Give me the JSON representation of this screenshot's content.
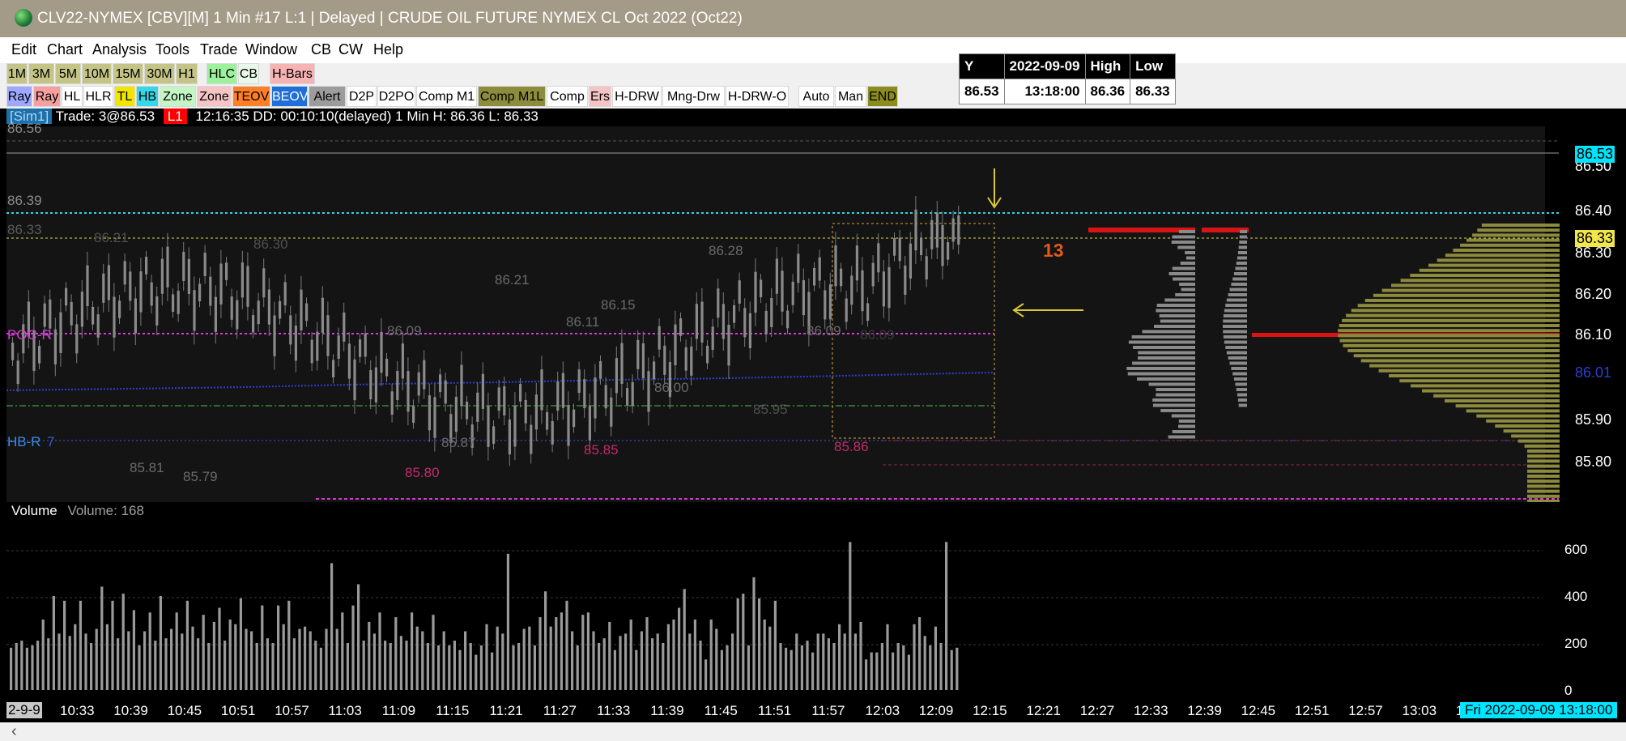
{
  "window": {
    "title": "CLV22-NYMEX [CBV][M]  1 Min   #17 L:1 | Delayed | CRUDE OIL FUTURE NYMEX CL Oct 2022 (Oct22)",
    "icon": "globe-icon"
  },
  "menu": [
    "Edit",
    "Chart",
    "Analysis",
    "Tools",
    "Trade",
    "Window",
    "CB",
    "CW",
    "Help"
  ],
  "toolbar_timeframes": [
    {
      "label": "1M",
      "color": "#c4c486"
    },
    {
      "label": "3M",
      "color": "#c4c486"
    },
    {
      "label": "5M",
      "color": "#c4c486"
    },
    {
      "label": "10M",
      "color": "#c4c486"
    },
    {
      "label": "15M",
      "color": "#c4c486"
    },
    {
      "label": "30M",
      "color": "#c4c486"
    },
    {
      "label": "H1",
      "color": "#c4c486"
    },
    {
      "label": "HLC",
      "color": "#9cf29c"
    },
    {
      "label": "CB",
      "color": "#e8f7e8"
    },
    {
      "label": "H-Bars",
      "color": "#f5b3b3"
    }
  ],
  "toolbar_tools": [
    {
      "label": "Ray",
      "color": "#9ea8ff"
    },
    {
      "label": "Ray",
      "color": "#f4a0a0"
    },
    {
      "label": "HL",
      "color": "#ffffff"
    },
    {
      "label": "HLR",
      "color": "#ffffff"
    },
    {
      "label": "TL",
      "color": "#f2e600"
    },
    {
      "label": "HB",
      "color": "#36d7e8"
    },
    {
      "label": "Zone",
      "color": "#c4f5c4"
    },
    {
      "label": "Zone",
      "color": "#f5c4c4"
    },
    {
      "label": "TEOV",
      "color": "#ff7f27"
    },
    {
      "label": "BEOV",
      "color": "#1e6fd9"
    },
    {
      "label": "Alert",
      "color": "#9c9c9c"
    },
    {
      "label": "D2P",
      "color": "#ffffff"
    },
    {
      "label": "D2PO",
      "color": "#ffffff"
    },
    {
      "label": "Comp M1",
      "color": "#ffffff"
    },
    {
      "label": "Comp M1L",
      "color": "#8c8c3c"
    },
    {
      "label": "Comp",
      "color": "#ffffff"
    },
    {
      "label": "Ers",
      "color": "#f5c4c4"
    },
    {
      "label": "H-DRW",
      "color": "#ffffff"
    },
    {
      "label": "Mng-Drw",
      "color": "#ffffff"
    },
    {
      "label": "H-DRW-O",
      "color": "#ffffff"
    },
    {
      "label": "Auto",
      "color": "#ffffff"
    },
    {
      "label": "Man",
      "color": "#ffffff"
    },
    {
      "label": "END",
      "color": "#8c8c1c"
    }
  ],
  "info_table": {
    "headers": [
      "Y",
      "2022-09-09",
      "High",
      "Low"
    ],
    "values": [
      "86.53",
      "13:18:00",
      "86.36",
      "86.33"
    ]
  },
  "status_line": {
    "sim": "[Sim1]",
    "trade": "Trade: 3@86.53",
    "badge": "L1",
    "text": "12:16:35 DD: 00:10:10(delayed) 1 Min  H: 86.36 L: 86.33"
  },
  "price_axis": {
    "ticks": [
      "86.50",
      "86.40",
      "86.30",
      "86.20",
      "86.10",
      "85.90",
      "85.80"
    ],
    "last_price": "86.53",
    "level_yellow": "86.33",
    "level_blue": "86.01"
  },
  "chart_labels": {
    "left_prices": [
      "86.56",
      "86.39",
      "86.33"
    ],
    "poc": "POC-R",
    "hb": "HB-R",
    "hb_suffix": "7",
    "count": "13",
    "swing_labels": [
      "86.21",
      "86.30",
      "86.28",
      "86.21",
      "86.15",
      "86.11",
      "86.09",
      "86.09",
      "86.09",
      "86.00",
      "85.95",
      "85.87",
      "85.81",
      "85.79",
      "85.80",
      "85.85",
      "85.86"
    ]
  },
  "chart_data": {
    "type": "bar",
    "title": "Volume",
    "subtitle": "Volume: 168",
    "ylim": [
      0,
      650
    ],
    "y_ticks": [
      0,
      200,
      400,
      600
    ],
    "x_tick_labels": [
      "10:33",
      "10:39",
      "10:45",
      "10:51",
      "10:57",
      "11:03",
      "11:09",
      "11:15",
      "11:21",
      "11:27",
      "11:33",
      "11:39",
      "11:45",
      "11:51",
      "11:57",
      "12:03",
      "12:09",
      "12:15",
      "12:21",
      "12:27",
      "12:33",
      "12:39",
      "12:45",
      "12:51",
      "12:57",
      "13:03",
      "1"
    ],
    "values": [
      180,
      200,
      210,
      180,
      190,
      210,
      300,
      220,
      400,
      240,
      380,
      230,
      280,
      380,
      240,
      200,
      260,
      440,
      280,
      380,
      220,
      410,
      250,
      340,
      190,
      250,
      330,
      210,
      400,
      220,
      260,
      330,
      240,
      380,
      270,
      220,
      320,
      200,
      290,
      350,
      210,
      300,
      280,
      390,
      260,
      250,
      200,
      360,
      220,
      200,
      360,
      280,
      380,
      220,
      260,
      270,
      250,
      210,
      180,
      260,
      540,
      260,
      330,
      200,
      360,
      450,
      210,
      290,
      240,
      330,
      210,
      200,
      310,
      230,
      210,
      330,
      270,
      250,
      200,
      320,
      190,
      250,
      190,
      210,
      170,
      250,
      200,
      150,
      190,
      280,
      160,
      270,
      240,
      580,
      190,
      200,
      260,
      270,
      190,
      310,
      420,
      270,
      310,
      330,
      380,
      250,
      190,
      320,
      330,
      250,
      200,
      220,
      290,
      170,
      230,
      240,
      300,
      170,
      250,
      310,
      220,
      240,
      200,
      280,
      300,
      350,
      430,
      240,
      300,
      210,
      130,
      300,
      260,
      170,
      190,
      240,
      390,
      410,
      190,
      480,
      390,
      300,
      270,
      380,
      200,
      180,
      170,
      240,
      190,
      210,
      160,
      240,
      240,
      220,
      200,
      280,
      240,
      630,
      240,
      290,
      130,
      160,
      160,
      200,
      280,
      160,
      200,
      190,
      150,
      280,
      310,
      230,
      190,
      270,
      200,
      630,
      170,
      180
    ],
    "last_value": 168
  },
  "time_axis": {
    "start_date": "2-9-9",
    "end_datetime": "Fri 2022-09-09  13:18:00"
  }
}
